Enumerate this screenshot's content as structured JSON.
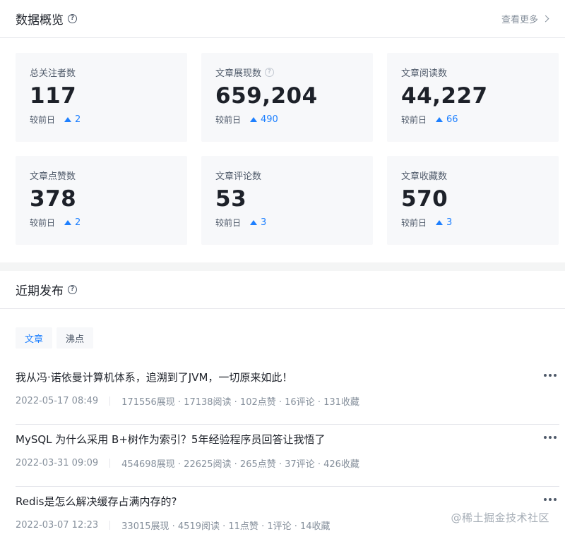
{
  "overview": {
    "title": "数据概览",
    "more_label": "查看更多",
    "stats": [
      {
        "label": "总关注者数",
        "value": "117",
        "delta_label": "较前日",
        "delta": "2",
        "help": false
      },
      {
        "label": "文章展现数",
        "value": "659,204",
        "delta_label": "较前日",
        "delta": "490",
        "help": true
      },
      {
        "label": "文章阅读数",
        "value": "44,227",
        "delta_label": "较前日",
        "delta": "66",
        "help": false
      },
      {
        "label": "文章点赞数",
        "value": "378",
        "delta_label": "较前日",
        "delta": "2",
        "help": false
      },
      {
        "label": "文章评论数",
        "value": "53",
        "delta_label": "较前日",
        "delta": "3",
        "help": false
      },
      {
        "label": "文章收藏数",
        "value": "570",
        "delta_label": "较前日",
        "delta": "3",
        "help": false
      }
    ]
  },
  "recent": {
    "title": "近期发布",
    "tabs": [
      {
        "label": "文章",
        "active": true
      },
      {
        "label": "沸点",
        "active": false
      }
    ],
    "articles": [
      {
        "title": "我从冯·诺依曼计算机体系，追溯到了JVM，一切原来如此！",
        "date": "2022-05-17 08:49",
        "stats": "171556展现 · 17138阅读 · 102点赞 · 16评论 · 131收藏"
      },
      {
        "title": "MySQL 为什么采用 B+树作为索引？5年经验程序员回答让我悟了",
        "date": "2022-03-31 09:09",
        "stats": "454698展现 · 22625阅读 · 265点赞 · 37评论 · 426收藏"
      },
      {
        "title": "Redis是怎么解决缓存占满内存的?",
        "date": "2022-03-07 12:23",
        "stats": "33015展现 · 4519阅读 · 11点赞 · 1评论 · 14收藏"
      }
    ]
  },
  "watermark": "@稀土掘金技术社区",
  "colors": {
    "accent": "#1e80ff",
    "text": "#1d2129",
    "muted": "#86909c"
  }
}
